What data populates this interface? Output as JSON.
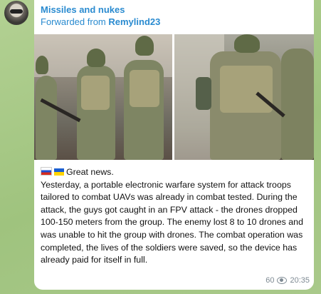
{
  "post": {
    "channel_name": "Missiles and nukes",
    "forwarded_prefix": "Forwarded from ",
    "forwarded_source": "Remylind23",
    "message_lines": [
      "Great news.",
      "Yesterday, a portable electronic warfare system for attack troops",
      "tailored to combat UAVs was already in combat tested. During the",
      "attack, the guys got caught in an FPV attack - the drones dropped",
      "100-150 meters from the group. The enemy lost 8 to 10 drones and",
      "was unable to hit the group with drones. The combat operation was",
      "completed, the lives of the soldiers were saved, so the device has",
      "already paid for itself in full."
    ],
    "views": "60",
    "time": "20:35"
  },
  "icons": {
    "avatar": "channel-avatar",
    "views": "eye-icon",
    "flags": [
      "russia-flag-icon",
      "ukraine-flag-icon"
    ]
  },
  "colors": {
    "link": "#2a8bd0",
    "bubble": "#ffffff",
    "meta": "#7e8a93"
  }
}
